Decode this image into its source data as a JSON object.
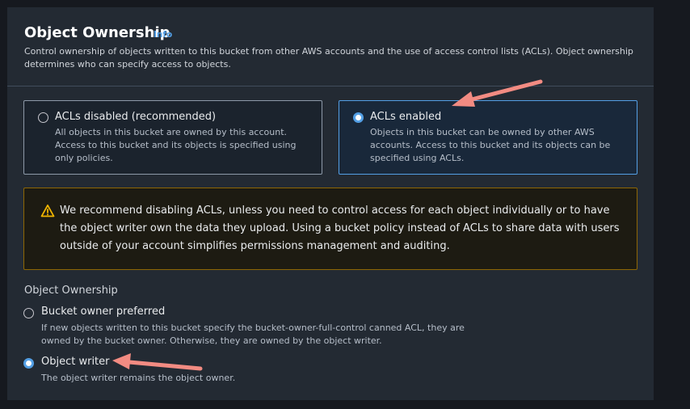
{
  "section": {
    "title": "Object Ownership",
    "info_link": "Info",
    "description": "Control ownership of objects written to this bucket from other AWS accounts and the use of access control lists (ACLs). Object ownership determines who can specify access to objects."
  },
  "acl_tiles": [
    {
      "label": "ACLs disabled (recommended)",
      "description": "All objects in this bucket are owned by this account. Access to this bucket and its objects is specified using only policies.",
      "selected": false
    },
    {
      "label": "ACLs enabled",
      "description": "Objects in this bucket can be owned by other AWS accounts. Access to this bucket and its objects can be specified using ACLs.",
      "selected": true
    }
  ],
  "alert": {
    "icon": "warning-icon",
    "text": "We recommend disabling ACLs, unless you need to control access for each object individually or to have the object writer own the data they upload. Using a bucket policy instead of ACLs to share data with users outside of your account simplifies permissions management and auditing."
  },
  "ownership": {
    "label": "Object Ownership",
    "options": [
      {
        "label": "Bucket owner preferred",
        "description": "If new objects written to this bucket specify the bucket-owner-full-control canned ACL, they are owned by the bucket owner. Otherwise, they are owned by the object writer.",
        "selected": false
      },
      {
        "label": "Object writer",
        "description": "The object writer remains the object owner.",
        "selected": true
      }
    ]
  },
  "colors": {
    "accent": "#539fe5",
    "annotation_arrow": "#f28b82",
    "warning": "#f2b600"
  }
}
